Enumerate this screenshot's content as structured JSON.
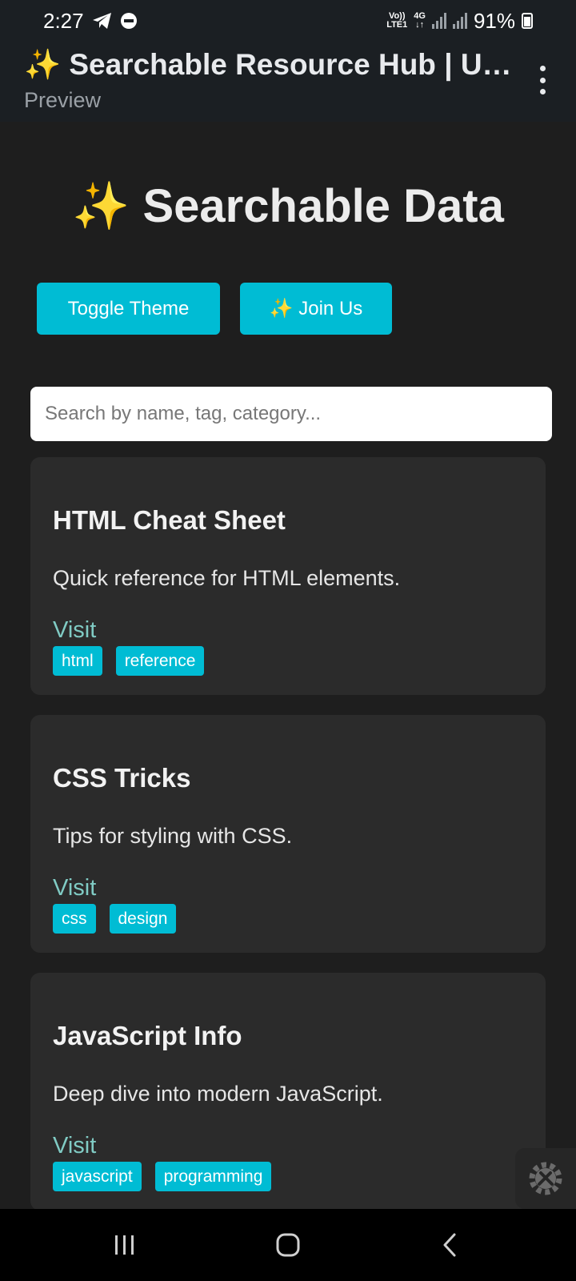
{
  "status_bar": {
    "time": "2:27",
    "network_top": "Vo))",
    "network_bottom": "LTE1",
    "network_type": "4G",
    "battery": "91%"
  },
  "app_bar": {
    "title": "✨ Searchable Resource Hub | UnK...",
    "subtitle": "Preview"
  },
  "page": {
    "heading": "✨ Searchable Data",
    "toggle_theme_label": "Toggle Theme",
    "join_label": "✨ Join Us",
    "search_placeholder": "Search by name, tag, category..."
  },
  "cards": [
    {
      "title": "HTML Cheat Sheet",
      "description": "Quick reference for HTML elements.",
      "link": "Visit",
      "tags": [
        "html",
        "reference"
      ]
    },
    {
      "title": "CSS Tricks",
      "description": "Tips for styling with CSS.",
      "link": "Visit",
      "tags": [
        "css",
        "design"
      ]
    },
    {
      "title": "JavaScript Info",
      "description": "Deep dive into modern JavaScript.",
      "link": "Visit",
      "tags": [
        "javascript",
        "programming"
      ]
    }
  ],
  "colors": {
    "accent": "#00bcd4",
    "link": "#80cbc4",
    "card_bg": "#2b2b2b",
    "page_bg": "#1e1e1e"
  },
  "icons": {
    "fab": "settings-tools-icon",
    "nav_recents": "recents-icon",
    "nav_home": "home-icon",
    "nav_back": "back-icon"
  }
}
